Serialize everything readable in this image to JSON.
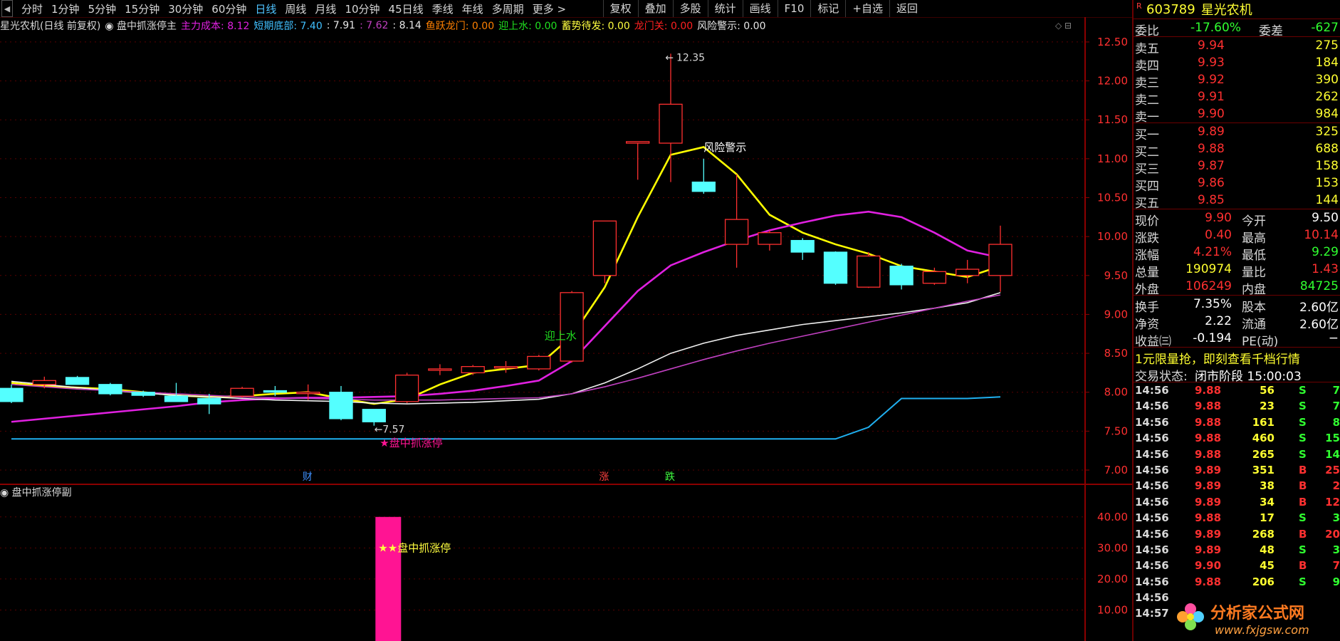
{
  "toolbar": {
    "left_arrow": "◀",
    "periods": [
      {
        "label": "分时",
        "active": false
      },
      {
        "label": "1分钟",
        "active": false
      },
      {
        "label": "5分钟",
        "active": false
      },
      {
        "label": "15分钟",
        "active": false
      },
      {
        "label": "30分钟",
        "active": false
      },
      {
        "label": "60分钟",
        "active": false
      },
      {
        "label": "日线",
        "active": true
      },
      {
        "label": "周线",
        "active": false
      },
      {
        "label": "月线",
        "active": false
      },
      {
        "label": "10分钟",
        "active": false
      },
      {
        "label": "45日线",
        "active": false
      },
      {
        "label": "季线",
        "active": false
      },
      {
        "label": "年线",
        "active": false
      },
      {
        "label": "多周期",
        "active": false
      },
      {
        "label": "更多 >",
        "active": false
      }
    ],
    "tools": [
      "复权",
      "叠加",
      "多股",
      "统计",
      "画线",
      "F10",
      "标记",
      "+自选",
      "返回"
    ]
  },
  "indicator_header": [
    {
      "text": "星光农机(日线 前复权)",
      "color": "#d8d8d8"
    },
    {
      "text": "◉ 盘中抓涨停主",
      "color": "#d8d8d8"
    },
    {
      "text": "主力成本: 8.12",
      "color": "#e020e0"
    },
    {
      "text": "短期底部: 7.40",
      "color": "#40c0ff"
    },
    {
      "text": ": 7.91",
      "color": "#e8e8e8"
    },
    {
      "text": ": 7.62",
      "color": "#c040c0"
    },
    {
      "text": ": 8.14",
      "color": "#e8e8e8"
    },
    {
      "text": "鱼跃龙门: 0.00",
      "color": "#ff8000"
    },
    {
      "text": "迎上水: 0.00",
      "color": "#20e020"
    },
    {
      "text": "蓄势待发: 0.00",
      "color": "#ffff40"
    },
    {
      "text": "龙门关: 0.00",
      "color": "#ff2020"
    },
    {
      "text": "风险警示: 0.00",
      "color": "#e8e8e8"
    }
  ],
  "chart_data": {
    "type": "candlestick",
    "ylim": [
      7.0,
      12.6
    ],
    "y_ticks": [
      "12.50",
      "12.00",
      "11.50",
      "11.00",
      "10.50",
      "10.00",
      "9.50",
      "9.00",
      "8.50",
      "8.00",
      "7.50",
      "7.00"
    ],
    "candles": [
      {
        "o": 8.05,
        "h": 8.1,
        "l": 7.86,
        "c": 7.88
      },
      {
        "o": 8.1,
        "h": 8.2,
        "l": 8.05,
        "c": 8.15
      },
      {
        "o": 8.19,
        "h": 8.21,
        "l": 8.1,
        "c": 8.1
      },
      {
        "o": 8.1,
        "h": 8.12,
        "l": 7.96,
        "c": 7.98
      },
      {
        "o": 8.0,
        "h": 8.02,
        "l": 7.94,
        "c": 7.96
      },
      {
        "o": 7.95,
        "h": 8.12,
        "l": 7.88,
        "c": 7.88
      },
      {
        "o": 7.92,
        "h": 7.98,
        "l": 7.72,
        "c": 7.85
      },
      {
        "o": 7.95,
        "h": 8.07,
        "l": 7.93,
        "c": 8.05
      },
      {
        "o": 8.02,
        "h": 8.08,
        "l": 7.95,
        "c": 8.0
      },
      {
        "o": 8.0,
        "h": 8.1,
        "l": 7.9,
        "c": 8.0
      },
      {
        "o": 8.0,
        "h": 8.08,
        "l": 7.64,
        "c": 7.66
      },
      {
        "o": 7.78,
        "h": 7.78,
        "l": 7.57,
        "c": 7.62
      },
      {
        "o": 7.88,
        "h": 8.25,
        "l": 7.86,
        "c": 8.22
      },
      {
        "o": 8.3,
        "h": 8.36,
        "l": 8.22,
        "c": 8.3
      },
      {
        "o": 8.25,
        "h": 8.35,
        "l": 8.22,
        "c": 8.33
      },
      {
        "o": 8.33,
        "h": 8.4,
        "l": 8.25,
        "c": 8.33
      },
      {
        "o": 8.3,
        "h": 8.48,
        "l": 8.28,
        "c": 8.46
      },
      {
        "o": 8.4,
        "h": 9.3,
        "l": 8.38,
        "c": 9.28
      },
      {
        "o": 9.5,
        "h": 10.2,
        "l": 9.4,
        "c": 10.2
      },
      {
        "o": 11.2,
        "h": 11.22,
        "l": 10.73,
        "c": 11.22
      },
      {
        "o": 11.2,
        "h": 12.35,
        "l": 10.7,
        "c": 11.7
      },
      {
        "o": 10.7,
        "h": 11.0,
        "l": 10.55,
        "c": 10.58
      },
      {
        "o": 9.9,
        "h": 10.8,
        "l": 9.6,
        "c": 10.22
      },
      {
        "o": 9.9,
        "h": 10.08,
        "l": 9.82,
        "c": 10.05
      },
      {
        "o": 9.95,
        "h": 9.98,
        "l": 9.7,
        "c": 9.8
      },
      {
        "o": 9.8,
        "h": 9.81,
        "l": 9.38,
        "c": 9.4
      },
      {
        "o": 9.35,
        "h": 9.8,
        "l": 9.34,
        "c": 9.75
      },
      {
        "o": 9.62,
        "h": 9.65,
        "l": 9.32,
        "c": 9.38
      },
      {
        "o": 9.4,
        "h": 9.6,
        "l": 9.38,
        "c": 9.55
      },
      {
        "o": 9.5,
        "h": 9.7,
        "l": 9.4,
        "c": 9.58
      },
      {
        "o": 9.5,
        "h": 10.14,
        "l": 9.29,
        "c": 9.9
      }
    ],
    "series": [
      {
        "color": "#ffff00",
        "values": [
          8.12,
          8.08,
          8.06,
          8.04,
          8.0,
          7.96,
          7.94,
          7.95,
          7.98,
          8.0,
          7.92,
          7.85,
          7.91,
          8.1,
          8.25,
          8.3,
          8.35,
          8.72,
          9.35,
          10.25,
          11.05,
          11.15,
          10.8,
          10.28,
          10.05,
          9.9,
          9.78,
          9.62,
          9.55,
          9.48,
          9.62
        ]
      },
      {
        "color": "#e020e0",
        "values": [
          7.62,
          7.66,
          7.7,
          7.74,
          7.78,
          7.82,
          7.87,
          7.9,
          7.92,
          7.93,
          7.93,
          7.94,
          7.95,
          7.98,
          8.02,
          8.08,
          8.15,
          8.4,
          8.85,
          9.3,
          9.63,
          9.8,
          9.95,
          10.08,
          10.18,
          10.27,
          10.32,
          10.25,
          10.05,
          9.82,
          9.73
        ]
      },
      {
        "color": "#f0f0f0",
        "values": [
          8.14,
          8.1,
          8.06,
          8.02,
          7.99,
          7.96,
          7.94,
          7.92,
          7.9,
          7.89,
          7.88,
          7.86,
          7.85,
          7.86,
          7.87,
          7.89,
          7.91,
          7.98,
          8.12,
          8.3,
          8.5,
          8.63,
          8.73,
          8.8,
          8.87,
          8.92,
          8.97,
          9.02,
          9.08,
          9.15,
          9.28
        ]
      },
      {
        "color": "#c040c0",
        "values": [
          8.1,
          8.07,
          8.04,
          8.02,
          8.0,
          7.98,
          7.96,
          7.94,
          7.93,
          7.92,
          7.91,
          7.9,
          7.9,
          7.9,
          7.91,
          7.92,
          7.93,
          7.98,
          8.07,
          8.18,
          8.3,
          8.42,
          8.53,
          8.63,
          8.72,
          8.81,
          8.9,
          8.99,
          9.08,
          9.17,
          9.25
        ]
      },
      {
        "color": "#20b0f0",
        "values": [
          7.4,
          7.4,
          7.4,
          7.4,
          7.4,
          7.4,
          7.4,
          7.4,
          7.4,
          7.4,
          7.4,
          7.4,
          7.4,
          7.4,
          7.4,
          7.4,
          7.4,
          7.4,
          7.4,
          7.4,
          7.4,
          7.4,
          7.4,
          7.4,
          7.4,
          7.4,
          7.55,
          7.92,
          7.92,
          7.92,
          7.94
        ]
      }
    ],
    "annotations": {
      "high_label": "12.35",
      "low_label": "7.57",
      "risk": "风险警示",
      "up_water": "迎上水",
      "main_signal": "★盘中抓涨停",
      "markers": [
        {
          "text": "财",
          "color": "#4090ff"
        },
        {
          "text": "涨",
          "color": "#ff4040"
        },
        {
          "text": "跌",
          "color": "#40ff40"
        }
      ]
    },
    "sub": {
      "title": "◉ 盘中抓涨停副",
      "y_ticks": [
        "40.00",
        "30.00",
        "20.00",
        "10.00"
      ],
      "ylim": [
        0,
        45
      ],
      "bar": {
        "value": 40,
        "color": "#ff1493"
      },
      "signal": "★★盘中抓涨停"
    }
  },
  "quote": {
    "badge": "R",
    "code": "603789",
    "name": "星光农机",
    "weibi_label": "委比",
    "weibi": "-17.60%",
    "weicha_label": "委差",
    "weicha": "-627",
    "asks": [
      {
        "label": "卖五",
        "price": "9.94",
        "vol": "275"
      },
      {
        "label": "卖四",
        "price": "9.93",
        "vol": "184"
      },
      {
        "label": "卖三",
        "price": "9.92",
        "vol": "390"
      },
      {
        "label": "卖二",
        "price": "9.91",
        "vol": "262"
      },
      {
        "label": "卖一",
        "price": "9.90",
        "vol": "984"
      }
    ],
    "bids": [
      {
        "label": "买一",
        "price": "9.89",
        "vol": "325"
      },
      {
        "label": "买二",
        "price": "9.88",
        "vol": "688"
      },
      {
        "label": "买三",
        "price": "9.87",
        "vol": "158"
      },
      {
        "label": "买四",
        "price": "9.86",
        "vol": "153"
      },
      {
        "label": "买五",
        "price": "9.85",
        "vol": "144"
      }
    ],
    "stats": [
      {
        "l1": "现价",
        "v1": "9.90",
        "c1": "#ff3030",
        "l2": "今开",
        "v2": "9.50",
        "c2": "#ffffff"
      },
      {
        "l1": "涨跌",
        "v1": "0.40",
        "c1": "#ff3030",
        "l2": "最高",
        "v2": "10.14",
        "c2": "#ff3030"
      },
      {
        "l1": "涨幅",
        "v1": "4.21%",
        "c1": "#ff3030",
        "l2": "最低",
        "v2": "9.29",
        "c2": "#30ff30"
      },
      {
        "l1": "总量",
        "v1": "190974",
        "c1": "#ffff30",
        "l2": "量比",
        "v2": "1.43",
        "c2": "#ff3030"
      },
      {
        "l1": "外盘",
        "v1": "106249",
        "c1": "#ff3030",
        "l2": "内盘",
        "v2": "84725",
        "c2": "#30ff30"
      }
    ],
    "stats2": [
      {
        "l1": "换手",
        "v1": "7.35%",
        "l2": "股本",
        "v2": "2.60亿"
      },
      {
        "l1": "净资",
        "v1": "2.22",
        "l2": "流通",
        "v2": "2.60亿"
      },
      {
        "l1": "收益㈢",
        "v1": "-0.194",
        "l2": "PE(动)",
        "v2": "−"
      }
    ],
    "promo": "1元限量抢，即刻查看千档行情",
    "status_label": "交易状态:",
    "status": "闭市阶段 15:00:03",
    "ticks": [
      {
        "t": "14:56",
        "p": "9.88",
        "v": "56",
        "s": "S",
        "n": "7"
      },
      {
        "t": "14:56",
        "p": "9.88",
        "v": "23",
        "s": "S",
        "n": "7"
      },
      {
        "t": "14:56",
        "p": "9.88",
        "v": "161",
        "s": "S",
        "n": "8"
      },
      {
        "t": "14:56",
        "p": "9.88",
        "v": "460",
        "s": "S",
        "n": "15"
      },
      {
        "t": "14:56",
        "p": "9.88",
        "v": "265",
        "s": "S",
        "n": "14"
      },
      {
        "t": "14:56",
        "p": "9.89",
        "v": "351",
        "s": "B",
        "n": "25"
      },
      {
        "t": "14:56",
        "p": "9.89",
        "v": "38",
        "s": "B",
        "n": "2"
      },
      {
        "t": "14:56",
        "p": "9.89",
        "v": "34",
        "s": "B",
        "n": "12"
      },
      {
        "t": "14:56",
        "p": "9.88",
        "v": "17",
        "s": "S",
        "n": "3"
      },
      {
        "t": "14:56",
        "p": "9.89",
        "v": "268",
        "s": "B",
        "n": "20"
      },
      {
        "t": "14:56",
        "p": "9.89",
        "v": "48",
        "s": "S",
        "n": "3"
      },
      {
        "t": "14:56",
        "p": "9.90",
        "v": "45",
        "s": "B",
        "n": "7"
      },
      {
        "t": "14:56",
        "p": "9.88",
        "v": "206",
        "s": "S",
        "n": "9"
      },
      {
        "t": "14:56",
        "p": "",
        "v": "",
        "s": "",
        "n": ""
      },
      {
        "t": "14:57",
        "p": "",
        "v": "",
        "s": "",
        "n": ""
      }
    ]
  },
  "watermark": {
    "name": "分析家公式网",
    "url": "www.fxjgsw.com"
  }
}
